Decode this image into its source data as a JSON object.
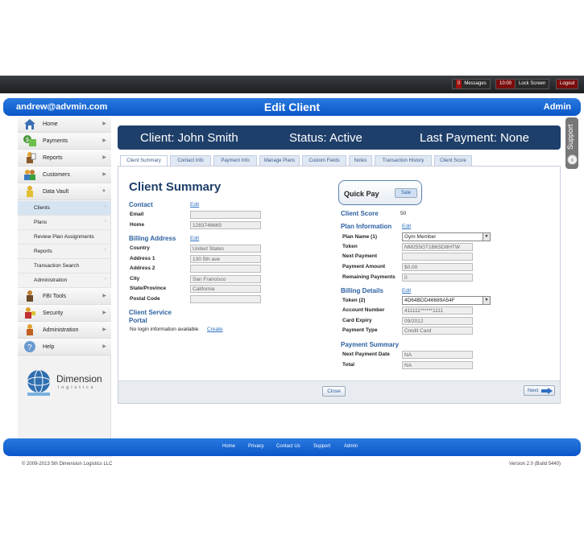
{
  "topbar": {
    "messages_count": "0",
    "messages_label": "Messages",
    "time": "10:00",
    "lock_label": "Lock Screen",
    "logout_label": "Logout"
  },
  "header": {
    "user": "andrew@advmin.com",
    "title": "Edit Client",
    "role": "Admin"
  },
  "sidebar": {
    "items": [
      {
        "label": "Home"
      },
      {
        "label": "Payments"
      },
      {
        "label": "Reports"
      },
      {
        "label": "Customers"
      },
      {
        "label": "Data Vault"
      }
    ],
    "sub": [
      {
        "label": "Clients"
      },
      {
        "label": "Plans"
      },
      {
        "label": "Review Plan Assignments"
      },
      {
        "label": "Reports"
      },
      {
        "label": "Transaction Search"
      },
      {
        "label": "Administration"
      }
    ],
    "items2": [
      {
        "label": "FBI Tools"
      },
      {
        "label": "Security"
      },
      {
        "label": "Administration"
      },
      {
        "label": "Help"
      }
    ],
    "logo_text": "Dimension",
    "logo_sub": "logistics"
  },
  "banner": {
    "client": "Client: John Smith",
    "status": "Status: Active",
    "last_payment": "Last Payment: None"
  },
  "support_label": "Support",
  "tabs": [
    "Client Summary",
    "Contact Info",
    "Payment Info",
    "Manage Plans",
    "Custom Fields",
    "Notes",
    "Transaction History",
    "Client Score"
  ],
  "summary": {
    "title": "Client Summary",
    "contact": {
      "heading": "Contact",
      "edit": "Edit",
      "email_label": "Email",
      "email": "",
      "home_label": "Home",
      "home": "1283746665"
    },
    "billing": {
      "heading": "Billing Address",
      "edit": "Edit",
      "country_label": "Country",
      "country": "United States",
      "addr1_label": "Address 1",
      "addr1": "130 5th ave",
      "addr2_label": "Address 2",
      "addr2": "",
      "city_label": "City",
      "city": "San Francisco",
      "state_label": "State/Province",
      "state": "California",
      "postal_label": "Postal Code",
      "postal": ""
    },
    "portal": {
      "heading1": "Client Service",
      "heading2": "Portal",
      "text": "No login information available",
      "create": "Create"
    },
    "quickpay": {
      "label": "Quick Pay",
      "sale": "Sale"
    },
    "score": {
      "heading": "Client Score",
      "value": "50"
    },
    "plan": {
      "heading": "Plan Information",
      "edit": "Edit",
      "name_label": "Plan Name (1)",
      "name": "Gym Member",
      "token_label": "Token",
      "token": "NM255GT1B6SD8HTW",
      "next_label": "Next Payment",
      "next": "",
      "amount_label": "Payment Amount",
      "amount": "$0.00",
      "remaining_label": "Remaining Payments",
      "remaining": "0"
    },
    "billing_details": {
      "heading": "Billing Details",
      "edit": "Edit",
      "token_label": "Token (2)",
      "token": "4D64BDD46689A54F",
      "acct_label": "Account Number",
      "acct": "411111******1111",
      "expiry_label": "Card Expiry",
      "expiry": "09/2012",
      "type_label": "Payment Type",
      "type": "Credit Card"
    },
    "payment_summary": {
      "heading": "Payment Summary",
      "next_label": "Next Payment Date",
      "next": "NA",
      "total_label": "Total",
      "total": "NA"
    }
  },
  "buttons": {
    "close": "Close",
    "next": "Next"
  },
  "footer": {
    "links": [
      "Home",
      "Privacy",
      "Contact Us",
      "Support",
      "Admin"
    ],
    "copyright": "© 2009-2013 5th Dimension Logistics LLC",
    "version": "Version 2.0 (Build 5440)"
  },
  "colors": {
    "brand_blue": "#0a56c8",
    "banner": "#1e3f6a",
    "accent": "#2c5fa0"
  }
}
